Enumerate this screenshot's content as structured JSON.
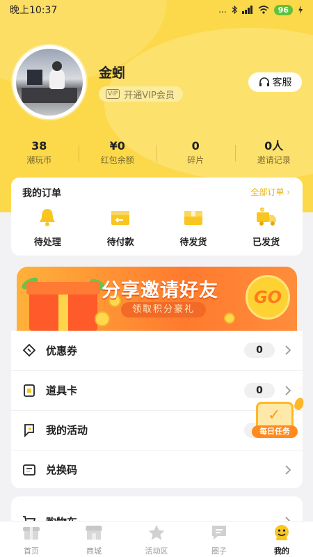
{
  "status_bar": {
    "time": "晚上10:37",
    "signal_dots": "...",
    "battery": "96"
  },
  "profile": {
    "nickname": "金蚓",
    "vip_text": "开通VIP会员",
    "vip_icon_text": "VIP",
    "service_label": "客服"
  },
  "stats": [
    {
      "value": "38",
      "label": "潮玩币"
    },
    {
      "value": "¥0",
      "label": "红包余额"
    },
    {
      "value": "0",
      "label": "碎片"
    },
    {
      "value": "0人",
      "label": "邀请记录"
    }
  ],
  "orders": {
    "title": "我的订单",
    "all_label": "全部订单 ›",
    "items": [
      {
        "label": "待处理",
        "icon": "bell-icon"
      },
      {
        "label": "待付款",
        "icon": "wallet-box-icon"
      },
      {
        "label": "待发货",
        "icon": "package-icon"
      },
      {
        "label": "已发货",
        "icon": "truck-icon"
      }
    ]
  },
  "banner": {
    "headline": "分享邀请好友",
    "subline": "领取积分豪礼",
    "go": "GO"
  },
  "menu": [
    {
      "label": "优惠券",
      "count": "0",
      "icon": "coupon-icon"
    },
    {
      "label": "道具卡",
      "count": "0",
      "icon": "card-icon"
    },
    {
      "label": "我的活动",
      "count": "",
      "icon": "flag-icon"
    },
    {
      "label": "兑换码",
      "count": "",
      "icon": "redeem-code-icon"
    }
  ],
  "menu2": [
    {
      "label": "购物车",
      "icon": "cart-icon"
    }
  ],
  "task_badge": {
    "label": "每日任务"
  },
  "tabbar": [
    {
      "label": "首页",
      "icon": "home-gift-icon",
      "active": false
    },
    {
      "label": "商城",
      "icon": "shop-icon",
      "active": false
    },
    {
      "label": "活动区",
      "icon": "star-icon",
      "active": false
    },
    {
      "label": "圈子",
      "icon": "chat-icon",
      "active": false
    },
    {
      "label": "我的",
      "icon": "profile-icon",
      "active": true
    }
  ],
  "colors": {
    "accent_yellow": "#fbd94a",
    "link_yellow": "#e6b400",
    "icon_yellow": "#f9c51f",
    "banner_orange": "#ff7a2e"
  }
}
